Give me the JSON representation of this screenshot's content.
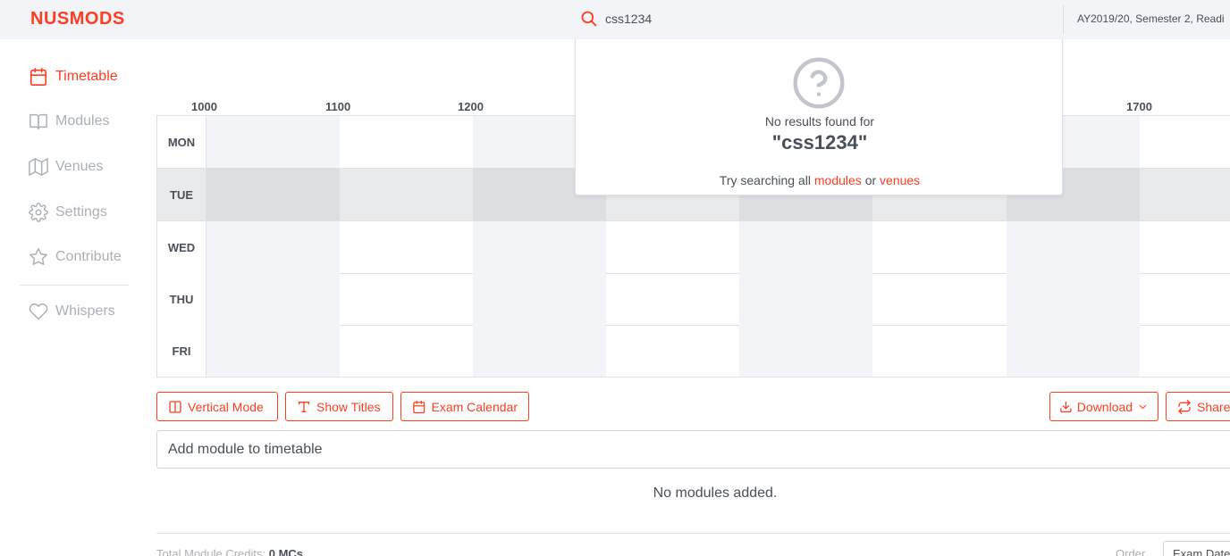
{
  "app": {
    "brand": "NUSMODS",
    "accent": "#ff3d22"
  },
  "search": {
    "value": "css1234",
    "icon": "search-icon"
  },
  "semester": {
    "label": "AY2019/20, Semester 2, Readi"
  },
  "sidebar": {
    "items": [
      {
        "label": "Timetable",
        "icon": "calendar-icon",
        "active": true
      },
      {
        "label": "Modules",
        "icon": "book-icon"
      },
      {
        "label": "Venues",
        "icon": "map-icon"
      },
      {
        "label": "Settings",
        "icon": "gear-icon"
      },
      {
        "label": "Contribute",
        "icon": "star-icon"
      },
      {
        "label": "Whispers",
        "icon": "heart-icon"
      }
    ]
  },
  "timetable": {
    "times": [
      "1000",
      "1100",
      "1200",
      "1700"
    ],
    "days": [
      "MON",
      "TUE",
      "WED",
      "THU",
      "FRI"
    ]
  },
  "toolbar": {
    "vertical_mode": "Vertical Mode",
    "show_titles": "Show Titles",
    "exam_calendar": "Exam Calendar",
    "download": "Download",
    "share": "Share"
  },
  "add_module": {
    "placeholder": "Add module to timetable"
  },
  "modules": {
    "empty_text": "No modules added."
  },
  "footer": {
    "credits_label": "Total Module Credits:",
    "credits_value": "0 MCs",
    "order_label": "Order",
    "order_value": "Exam Date"
  },
  "search_results": {
    "no_results_text": "No results found for",
    "query_display": "\"css1234\"",
    "try_prefix": "Try searching all",
    "modules_link": "modules",
    "or_text": "or",
    "venues_link": "venues"
  }
}
